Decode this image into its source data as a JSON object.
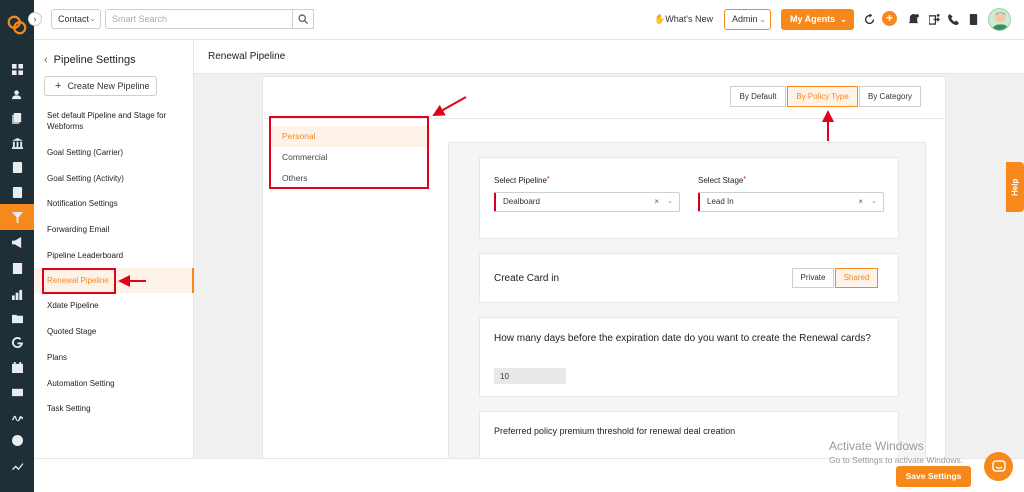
{
  "topbar": {
    "contact_select": "Contact",
    "search_placeholder": "Smart Search",
    "whats_new": "What's New",
    "admin_select": "Admin",
    "my_agents": "My Agents"
  },
  "sidebar": {
    "title": "Pipeline Settings",
    "create_button": "Create New Pipeline",
    "items": [
      {
        "label": "Set default Pipeline and Stage for Webforms"
      },
      {
        "label": "Goal Setting (Carrier)"
      },
      {
        "label": "Goal Setting (Activity)"
      },
      {
        "label": "Notification Settings"
      },
      {
        "label": "Forwarding Email"
      },
      {
        "label": "Pipeline Leaderboard"
      },
      {
        "label": "Renewal Pipeline"
      },
      {
        "label": "Xdate Pipeline"
      },
      {
        "label": "Quoted Stage"
      },
      {
        "label": "Plans"
      },
      {
        "label": "Automation Setting"
      },
      {
        "label": "Task Setting"
      }
    ],
    "active_item": "Renewal Pipeline"
  },
  "main": {
    "title": "Renewal Pipeline",
    "segments": [
      "By Default",
      "By Policy Type",
      "By Category"
    ],
    "active_segment": "By Policy Type",
    "policy_types": [
      "Personal",
      "Commercial",
      "Others"
    ],
    "active_policy_type": "Personal",
    "select_pipeline_label": "Select Pipeline",
    "select_pipeline_value": "Dealboard",
    "select_stage_label": "Select Stage",
    "select_stage_value": "Lead In",
    "create_card_label": "Create Card in",
    "create_card_options": [
      "Private",
      "Shared"
    ],
    "create_card_active": "Shared",
    "days_question": "How many days before the expiration date do you want to create the Renewal cards?",
    "days_value": "10",
    "threshold_label": "Preferred policy premium threshold for renewal deal creation"
  },
  "overlays": {
    "help": "Help",
    "activate_title": "Activate Windows",
    "activate_sub": "Go to Settings to activate Windows.",
    "save_button": "Save Settings"
  },
  "colors": {
    "accent": "#f7891c",
    "rail": "#1f2f37",
    "annotation": "#e3001b"
  }
}
